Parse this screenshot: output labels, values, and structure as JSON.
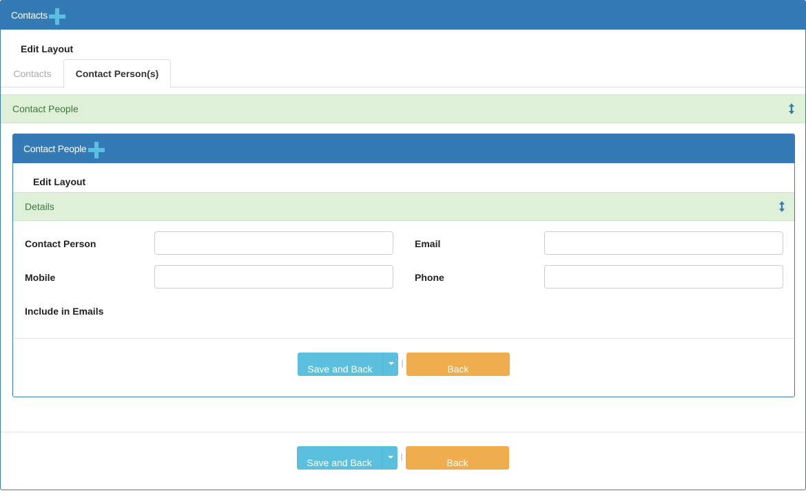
{
  "header": {
    "title": "Contacts",
    "add_icon": "plus-icon"
  },
  "edit_layout_label": "Edit Layout",
  "tabs": [
    {
      "label": "Contacts",
      "active": false
    },
    {
      "label": "Contact Person(s)",
      "active": true
    }
  ],
  "section": {
    "title": "Contact People",
    "collapse_icon": "vertical-resize-icon"
  },
  "subpanel": {
    "title": "Contact People",
    "edit_layout_label": "Edit Layout",
    "details_title": "Details",
    "fields": {
      "contact_person": {
        "label": "Contact Person",
        "value": ""
      },
      "email": {
        "label": "Email",
        "value": ""
      },
      "mobile": {
        "label": "Mobile",
        "value": ""
      },
      "phone": {
        "label": "Phone",
        "value": ""
      },
      "include_in_emails": {
        "label": "Include in Emails"
      }
    },
    "buttons": {
      "save_label": "Save and Back",
      "separator": "|",
      "back_label": "Back"
    }
  },
  "footer_buttons": {
    "save_label": "Save and Back",
    "separator": "|",
    "back_label": "Back"
  },
  "colors": {
    "primary": "#337ab7",
    "accent_icon": "#5bc0de",
    "success_bg": "#dff0d8",
    "success_text": "#3c763d",
    "info_button": "#5bc0de",
    "warning_button": "#f0ad4e"
  }
}
